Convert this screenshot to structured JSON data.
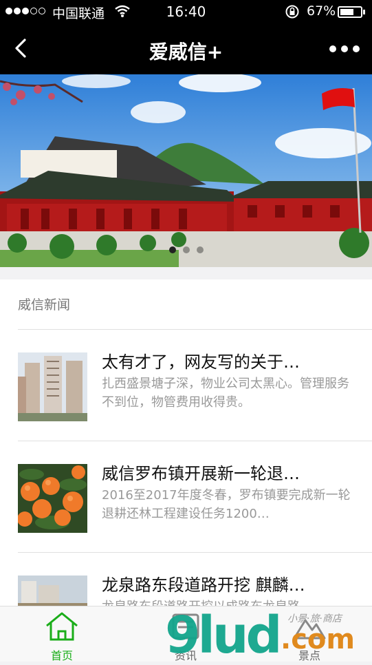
{
  "status": {
    "carrier": "中国联通",
    "time": "16:40",
    "battery": "67%",
    "battery_level": 0.67
  },
  "nav": {
    "title": "爱威信+"
  },
  "banner": {
    "slides": 3,
    "active": 0
  },
  "news": {
    "section_title": "威信新闻",
    "items": [
      {
        "title": "太有才了，网友写的关于…",
        "desc": "扎西盛景塘子深，物业公司太黑心。管理服务不到位，物管费用收得贵。"
      },
      {
        "title": "威信罗布镇开展新一轮退…",
        "desc": "2016至2017年度冬春，罗布镇要完成新一轮退耕还林工程建设任务1200…"
      },
      {
        "title": "龙泉路东段道路开挖 麒麟…",
        "desc": "龙泉路东段道路开挖以成路东龙泉路"
      }
    ]
  },
  "tabs": [
    {
      "label": "首页",
      "icon": "home-icon"
    },
    {
      "label": "资讯",
      "icon": "news-icon"
    },
    {
      "label": "景点",
      "icon": "scenic-icon"
    }
  ],
  "watermark": {
    "main": "9lud",
    "suffix": ".com",
    "sub": "小景·旅·商店"
  },
  "colors": {
    "accent": "#1aad19",
    "nav_bg": "#000000"
  }
}
